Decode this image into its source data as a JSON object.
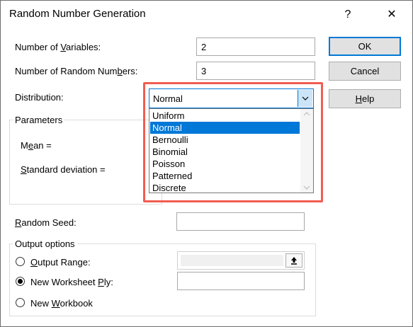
{
  "window": {
    "title": "Random Number Generation",
    "help_glyph": "?",
    "close_glyph": "✕"
  },
  "fields": {
    "num_variables": {
      "label_pre": "Number of ",
      "label_acc": "V",
      "label_post": "ariables:",
      "value": "2"
    },
    "num_random": {
      "label_pre": "Number of Random Num",
      "label_acc": "b",
      "label_post": "ers:",
      "value": "3"
    },
    "distribution": {
      "label_pre": "Distribution:",
      "value": "Normal"
    }
  },
  "parameters": {
    "title": "Parameters",
    "mean_pre": "M",
    "mean_acc": "e",
    "mean_post": "an =",
    "std_pre": "",
    "std_acc": "S",
    "std_post": "tandard deviation ="
  },
  "dropdown_options": [
    "Uniform",
    "Normal",
    "Bernoulli",
    "Binomial",
    "Poisson",
    "Patterned",
    "Discrete"
  ],
  "selected_option": "Normal",
  "random_seed": {
    "label_pre": "",
    "label_acc": "R",
    "label_post": "andom Seed:",
    "value": ""
  },
  "output": {
    "title": "Output options",
    "output_range": {
      "label_pre": "",
      "label_acc": "O",
      "label_post": "utput Range:",
      "value": ""
    },
    "new_ply": {
      "label_pre": "New Worksheet ",
      "label_acc": "P",
      "label_post": "ly:",
      "value": ""
    },
    "new_workbook": {
      "label_pre": "New ",
      "label_acc": "W",
      "label_post": "orkbook"
    },
    "selected": "new_ply"
  },
  "buttons": {
    "ok": "OK",
    "cancel": "Cancel",
    "help_pre": "",
    "help_acc": "H",
    "help_post": "elp"
  },
  "colors": {
    "accent": "#0078d7",
    "highlight": "#f25c50"
  }
}
